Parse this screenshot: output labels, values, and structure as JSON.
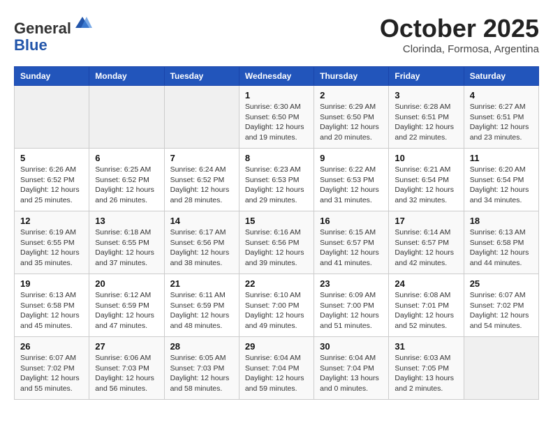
{
  "header": {
    "logo_line1": "General",
    "logo_line2": "Blue",
    "month": "October 2025",
    "location": "Clorinda, Formosa, Argentina"
  },
  "weekdays": [
    "Sunday",
    "Monday",
    "Tuesday",
    "Wednesday",
    "Thursday",
    "Friday",
    "Saturday"
  ],
  "weeks": [
    [
      {
        "day": "",
        "info": ""
      },
      {
        "day": "",
        "info": ""
      },
      {
        "day": "",
        "info": ""
      },
      {
        "day": "1",
        "info": "Sunrise: 6:30 AM\nSunset: 6:50 PM\nDaylight: 12 hours\nand 19 minutes."
      },
      {
        "day": "2",
        "info": "Sunrise: 6:29 AM\nSunset: 6:50 PM\nDaylight: 12 hours\nand 20 minutes."
      },
      {
        "day": "3",
        "info": "Sunrise: 6:28 AM\nSunset: 6:51 PM\nDaylight: 12 hours\nand 22 minutes."
      },
      {
        "day": "4",
        "info": "Sunrise: 6:27 AM\nSunset: 6:51 PM\nDaylight: 12 hours\nand 23 minutes."
      }
    ],
    [
      {
        "day": "5",
        "info": "Sunrise: 6:26 AM\nSunset: 6:52 PM\nDaylight: 12 hours\nand 25 minutes."
      },
      {
        "day": "6",
        "info": "Sunrise: 6:25 AM\nSunset: 6:52 PM\nDaylight: 12 hours\nand 26 minutes."
      },
      {
        "day": "7",
        "info": "Sunrise: 6:24 AM\nSunset: 6:52 PM\nDaylight: 12 hours\nand 28 minutes."
      },
      {
        "day": "8",
        "info": "Sunrise: 6:23 AM\nSunset: 6:53 PM\nDaylight: 12 hours\nand 29 minutes."
      },
      {
        "day": "9",
        "info": "Sunrise: 6:22 AM\nSunset: 6:53 PM\nDaylight: 12 hours\nand 31 minutes."
      },
      {
        "day": "10",
        "info": "Sunrise: 6:21 AM\nSunset: 6:54 PM\nDaylight: 12 hours\nand 32 minutes."
      },
      {
        "day": "11",
        "info": "Sunrise: 6:20 AM\nSunset: 6:54 PM\nDaylight: 12 hours\nand 34 minutes."
      }
    ],
    [
      {
        "day": "12",
        "info": "Sunrise: 6:19 AM\nSunset: 6:55 PM\nDaylight: 12 hours\nand 35 minutes."
      },
      {
        "day": "13",
        "info": "Sunrise: 6:18 AM\nSunset: 6:55 PM\nDaylight: 12 hours\nand 37 minutes."
      },
      {
        "day": "14",
        "info": "Sunrise: 6:17 AM\nSunset: 6:56 PM\nDaylight: 12 hours\nand 38 minutes."
      },
      {
        "day": "15",
        "info": "Sunrise: 6:16 AM\nSunset: 6:56 PM\nDaylight: 12 hours\nand 39 minutes."
      },
      {
        "day": "16",
        "info": "Sunrise: 6:15 AM\nSunset: 6:57 PM\nDaylight: 12 hours\nand 41 minutes."
      },
      {
        "day": "17",
        "info": "Sunrise: 6:14 AM\nSunset: 6:57 PM\nDaylight: 12 hours\nand 42 minutes."
      },
      {
        "day": "18",
        "info": "Sunrise: 6:13 AM\nSunset: 6:58 PM\nDaylight: 12 hours\nand 44 minutes."
      }
    ],
    [
      {
        "day": "19",
        "info": "Sunrise: 6:13 AM\nSunset: 6:58 PM\nDaylight: 12 hours\nand 45 minutes."
      },
      {
        "day": "20",
        "info": "Sunrise: 6:12 AM\nSunset: 6:59 PM\nDaylight: 12 hours\nand 47 minutes."
      },
      {
        "day": "21",
        "info": "Sunrise: 6:11 AM\nSunset: 6:59 PM\nDaylight: 12 hours\nand 48 minutes."
      },
      {
        "day": "22",
        "info": "Sunrise: 6:10 AM\nSunset: 7:00 PM\nDaylight: 12 hours\nand 49 minutes."
      },
      {
        "day": "23",
        "info": "Sunrise: 6:09 AM\nSunset: 7:00 PM\nDaylight: 12 hours\nand 51 minutes."
      },
      {
        "day": "24",
        "info": "Sunrise: 6:08 AM\nSunset: 7:01 PM\nDaylight: 12 hours\nand 52 minutes."
      },
      {
        "day": "25",
        "info": "Sunrise: 6:07 AM\nSunset: 7:02 PM\nDaylight: 12 hours\nand 54 minutes."
      }
    ],
    [
      {
        "day": "26",
        "info": "Sunrise: 6:07 AM\nSunset: 7:02 PM\nDaylight: 12 hours\nand 55 minutes."
      },
      {
        "day": "27",
        "info": "Sunrise: 6:06 AM\nSunset: 7:03 PM\nDaylight: 12 hours\nand 56 minutes."
      },
      {
        "day": "28",
        "info": "Sunrise: 6:05 AM\nSunset: 7:03 PM\nDaylight: 12 hours\nand 58 minutes."
      },
      {
        "day": "29",
        "info": "Sunrise: 6:04 AM\nSunset: 7:04 PM\nDaylight: 12 hours\nand 59 minutes."
      },
      {
        "day": "30",
        "info": "Sunrise: 6:04 AM\nSunset: 7:04 PM\nDaylight: 13 hours\nand 0 minutes."
      },
      {
        "day": "31",
        "info": "Sunrise: 6:03 AM\nSunset: 7:05 PM\nDaylight: 13 hours\nand 2 minutes."
      },
      {
        "day": "",
        "info": ""
      }
    ]
  ]
}
